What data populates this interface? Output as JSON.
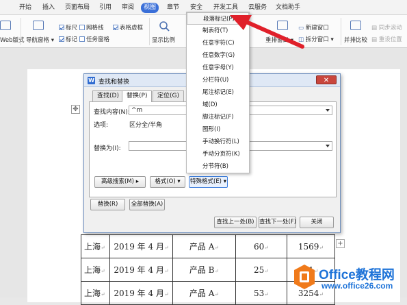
{
  "ribbon": {
    "tabs": [
      "开始",
      "插入",
      "页面布局",
      "引用",
      "审阅",
      "视图",
      "章节",
      "安全",
      "开发工具",
      "云服务",
      "文档助手"
    ],
    "active_tab": "视图"
  },
  "toolbar": {
    "web_layout": "Web版式",
    "nav_pane": "导航窗格",
    "ruler": "标尺",
    "gridlines": "网格线",
    "table_gridlines": "表格虚框",
    "markup": "标记",
    "task_pane": "任务窗格",
    "zoom": "显示比例",
    "rearrange": "重排窗口",
    "new_window": "新建窗口",
    "split_window": "拆分窗口",
    "side_by_side": "并排比较",
    "sync_scroll": "同步滚动",
    "reset_position": "重设位置"
  },
  "dialog": {
    "title": "查找和替换",
    "tabs": [
      "查找(D)",
      "替换(P)",
      "定位(G)"
    ],
    "selected_tab": "替换(P)",
    "find_label": "查找内容(N):",
    "find_value": "^m",
    "options_label": "选项:",
    "options_value": "区分全/半角",
    "replace_label": "替换为(I):",
    "replace_value": "",
    "advanced_btn": "高级搜索(M)",
    "format_btn": "格式(O)",
    "special_btn": "特殊格式(E)",
    "replace_btn": "替换(R)",
    "replace_all_btn": "全部替换(A)",
    "find_prev_btn": "查找上一处(B)",
    "find_next_btn": "查找下一处(F)",
    "close_btn": "关闭"
  },
  "special_menu": [
    "段落标记(P)",
    "制表符(T)",
    "任意字符(C)",
    "任意数字(G)",
    "任意字母(Y)",
    "分栏符(U)",
    "尾注标记(E)",
    "域(D)",
    "脚注标记(F)",
    "图形(I)",
    "手动换行符(L)",
    "手动分页符(K)",
    "分节符(B)"
  ],
  "document_table": [
    [
      "上海",
      "2019 年 4 月",
      "产品 A",
      "60",
      "1569"
    ],
    [
      "上海",
      "2019 年 4 月",
      "产品 B",
      "25",
      "51"
    ],
    [
      "上海",
      "2019 年 4 月",
      "产品 A",
      "53",
      "3254"
    ]
  ],
  "watermark": {
    "line1": "Office教程网",
    "line2": "www.office26.com"
  },
  "colors": {
    "accent": "#3a6fd8",
    "arrow": "#e0202a",
    "watermark": "#1e73d8"
  }
}
